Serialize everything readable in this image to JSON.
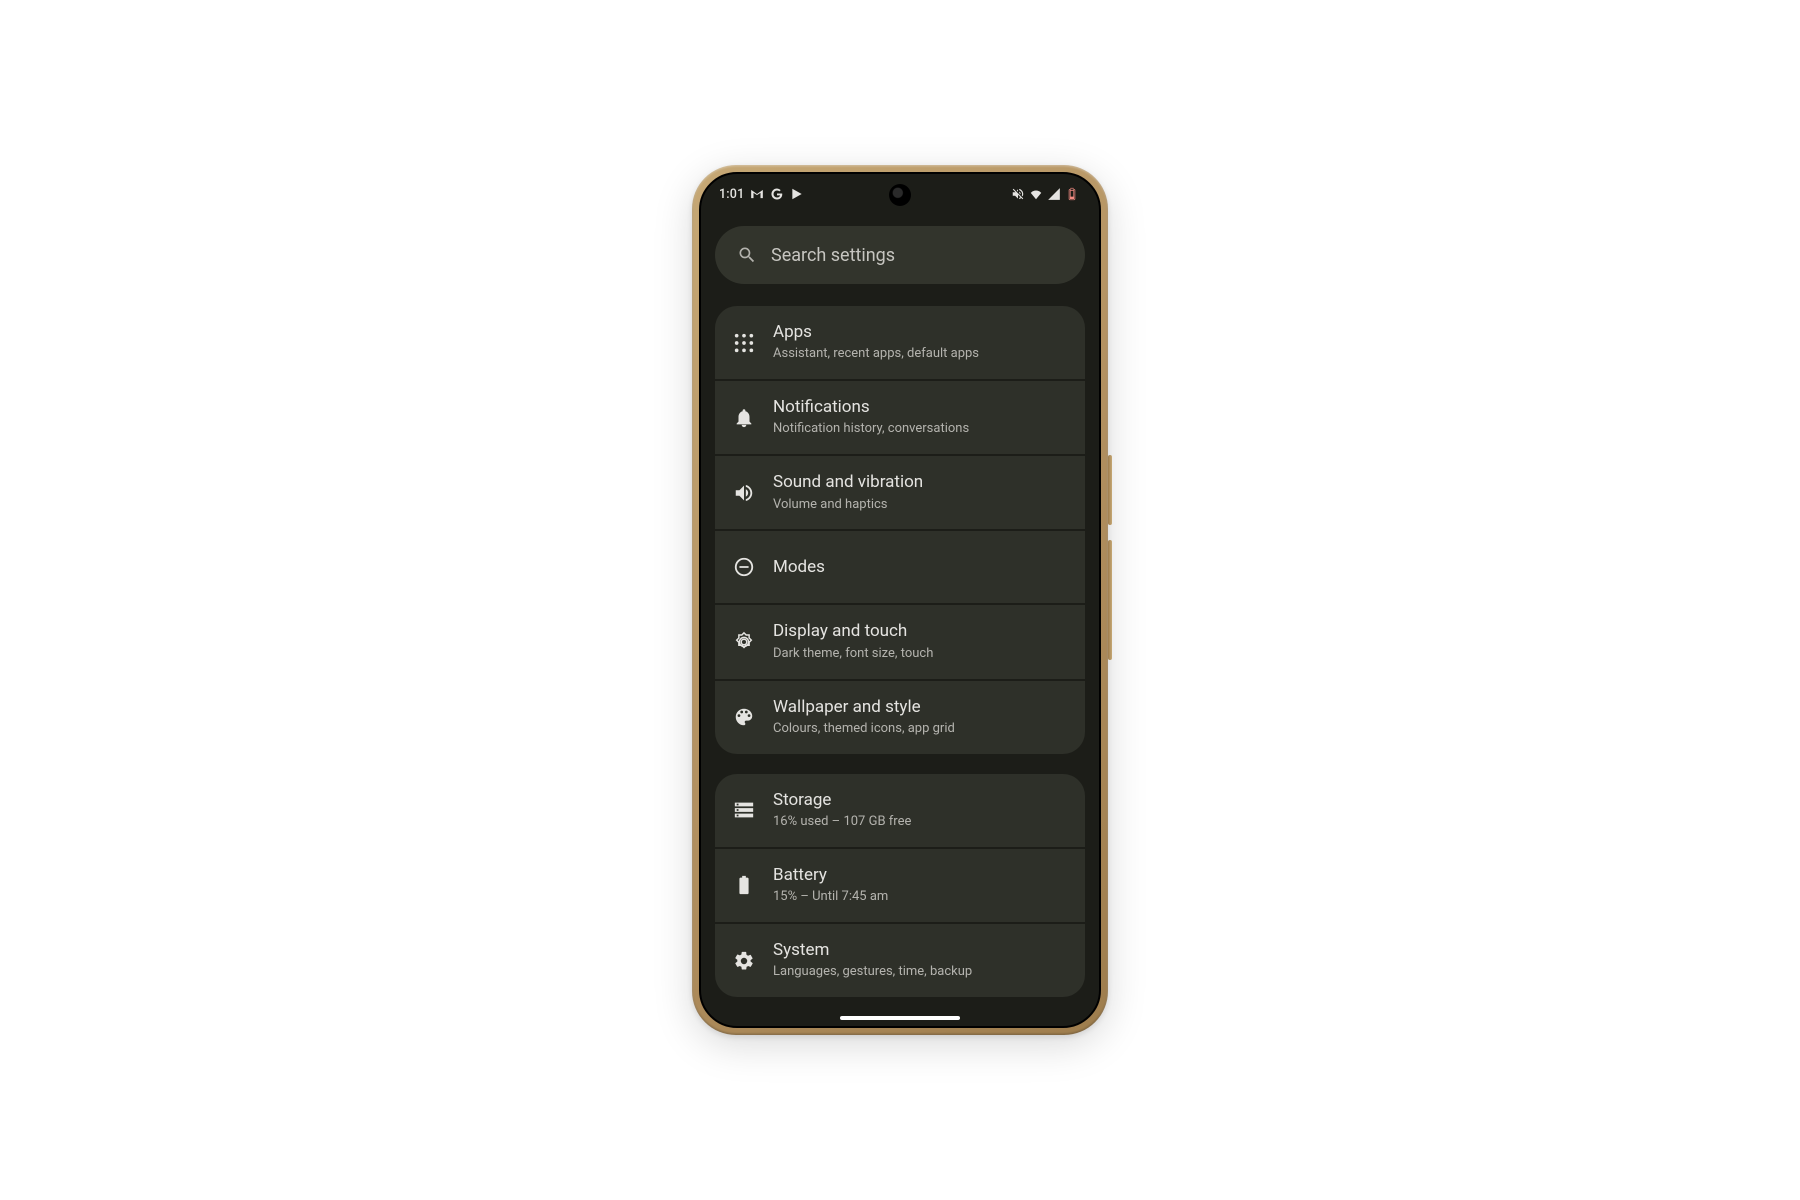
{
  "statusbar": {
    "time": "1:01",
    "left_icons": [
      "gmail",
      "google",
      "play"
    ],
    "right_icons": [
      "muted",
      "wifi",
      "signal",
      "battery-low"
    ]
  },
  "search": {
    "placeholder": "Search settings"
  },
  "groups": [
    {
      "rows": [
        {
          "id": "apps",
          "icon": "apps",
          "title": "Apps",
          "subtitle": "Assistant, recent apps, default apps"
        },
        {
          "id": "notifications",
          "icon": "bell",
          "title": "Notifications",
          "subtitle": "Notification history, conversations"
        },
        {
          "id": "sound",
          "icon": "volume",
          "title": "Sound and vibration",
          "subtitle": "Volume and haptics"
        },
        {
          "id": "modes",
          "icon": "dnd",
          "title": "Modes",
          "subtitle": ""
        },
        {
          "id": "display",
          "icon": "brightness",
          "title": "Display and touch",
          "subtitle": "Dark theme, font size, touch"
        },
        {
          "id": "wallpaper",
          "icon": "palette",
          "title": "Wallpaper and style",
          "subtitle": "Colours, themed icons, app grid"
        }
      ]
    },
    {
      "rows": [
        {
          "id": "storage",
          "icon": "storage",
          "title": "Storage",
          "subtitle": "16% used – 107 GB free"
        },
        {
          "id": "battery",
          "icon": "battery",
          "title": "Battery",
          "subtitle": "15% – Until 7:45 am"
        },
        {
          "id": "system",
          "icon": "gear",
          "title": "System",
          "subtitle": "Languages, gestures, time, backup"
        }
      ]
    }
  ]
}
